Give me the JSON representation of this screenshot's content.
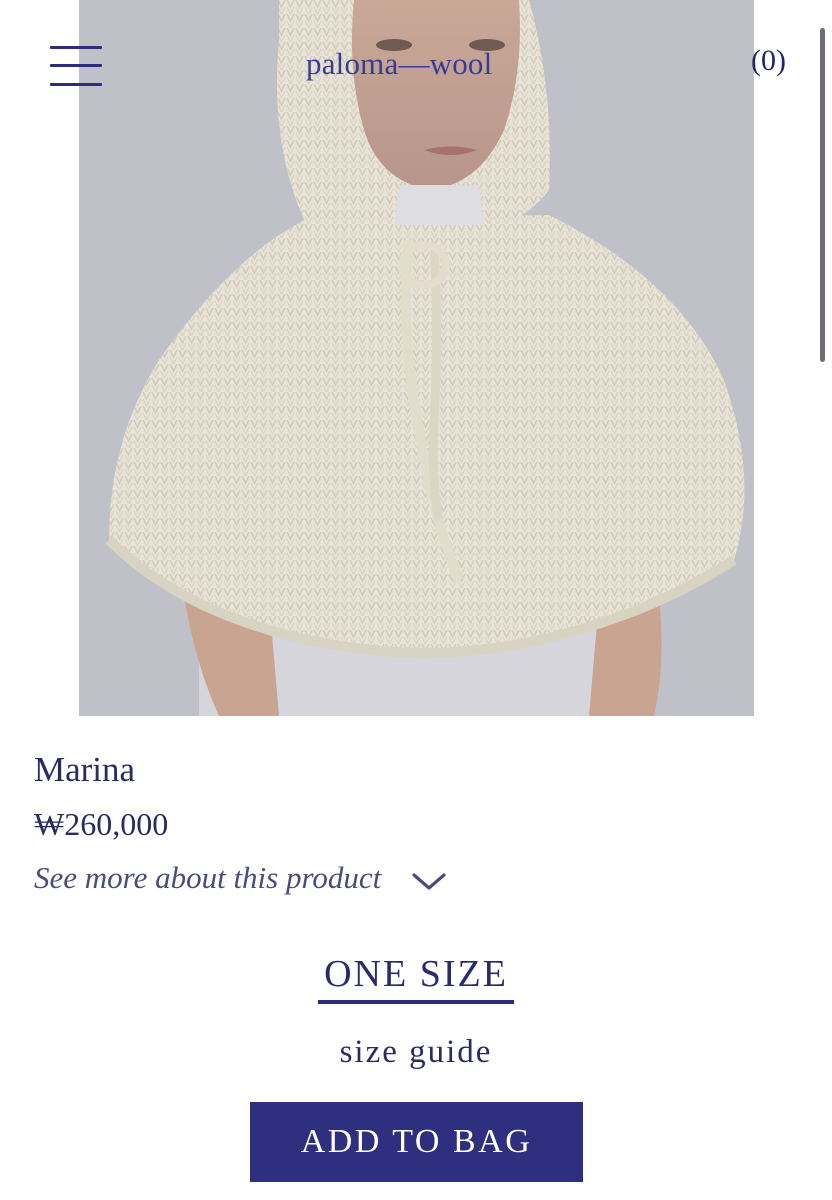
{
  "header": {
    "brand": "paloma—wool",
    "cart_count": "(0)",
    "menu_icon": "hamburger-menu-icon"
  },
  "product": {
    "name": "Marina",
    "price": "₩260,000",
    "more_link": "See more about this product",
    "size_option": "ONE SIZE",
    "size_guide": "size guide",
    "add_to_bag": "ADD TO BAG"
  },
  "colors": {
    "accent": "#2e2f7f",
    "text": "#2a2b63"
  }
}
